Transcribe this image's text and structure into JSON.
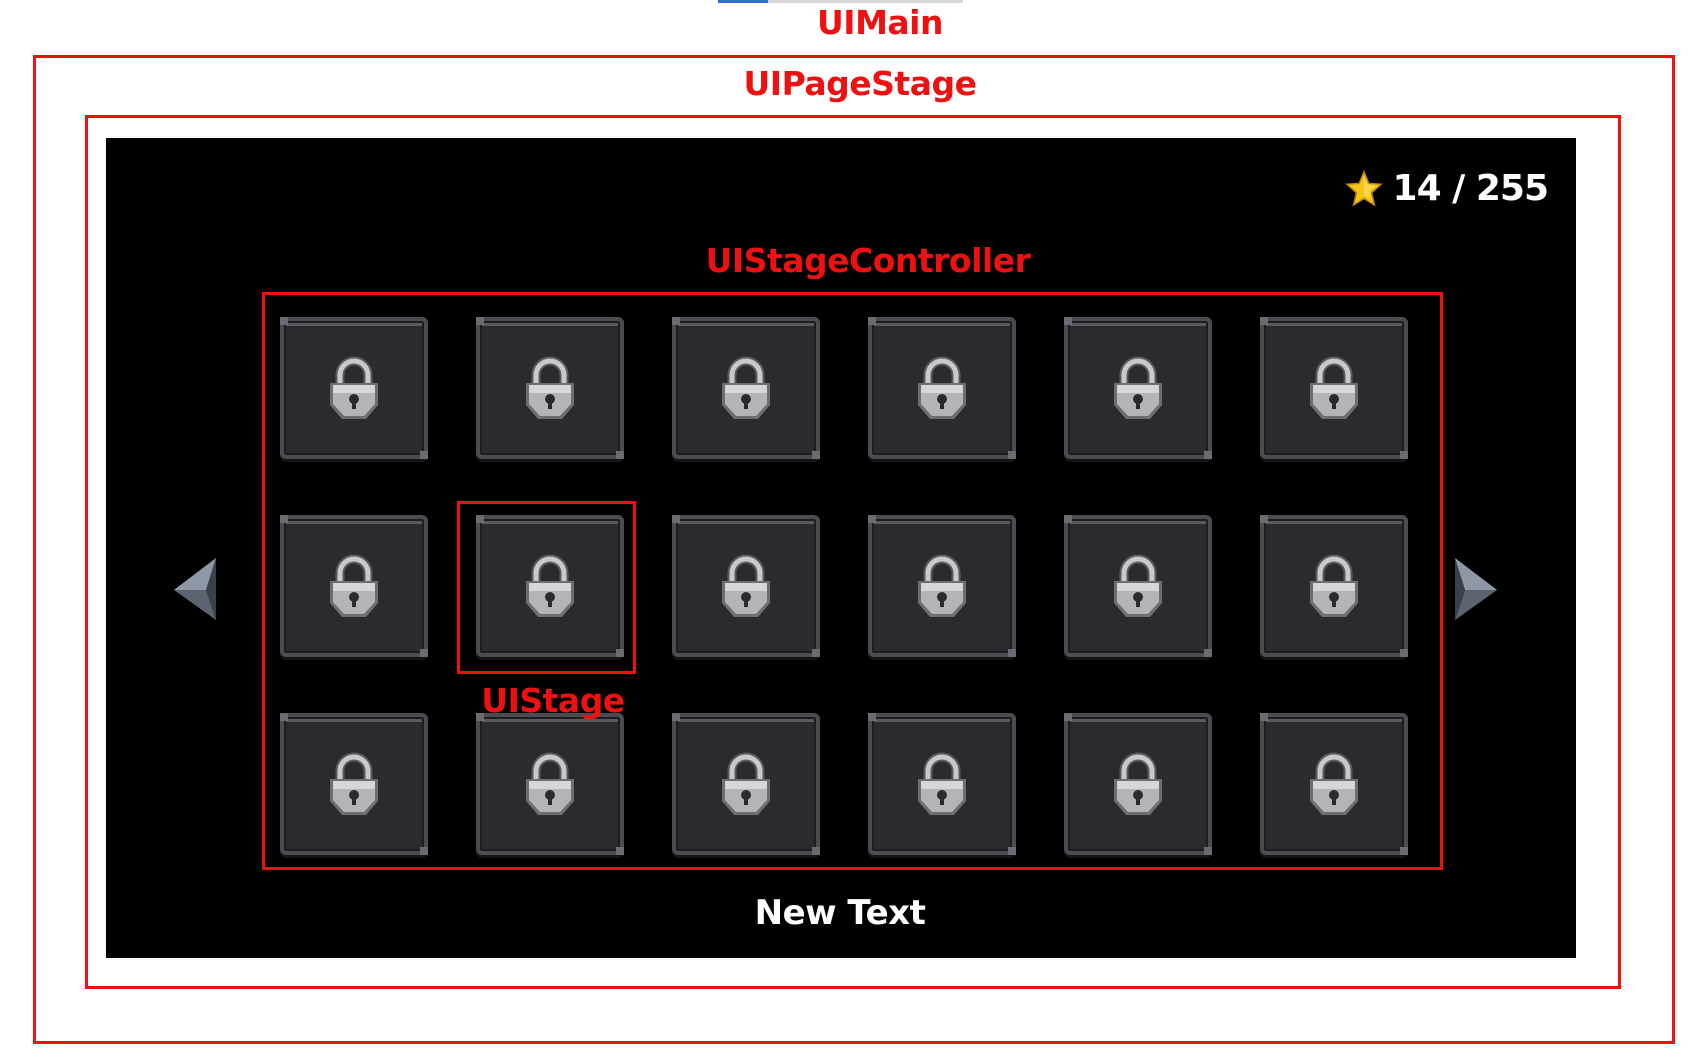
{
  "annotations": {
    "main_label": "UIMain",
    "page_label": "UIPageStage",
    "controller_label": "UIStageController",
    "stage_label": "UIStage"
  },
  "hud": {
    "star_icon": "star-icon",
    "star_count": "14 / 255"
  },
  "stage_grid": {
    "rows": 3,
    "columns": 6,
    "tiles": [
      {
        "state": "locked"
      },
      {
        "state": "locked"
      },
      {
        "state": "locked"
      },
      {
        "state": "locked"
      },
      {
        "state": "locked"
      },
      {
        "state": "locked"
      },
      {
        "state": "locked"
      },
      {
        "state": "locked"
      },
      {
        "state": "locked"
      },
      {
        "state": "locked"
      },
      {
        "state": "locked"
      },
      {
        "state": "locked"
      },
      {
        "state": "locked"
      },
      {
        "state": "locked"
      },
      {
        "state": "locked"
      },
      {
        "state": "locked"
      },
      {
        "state": "locked"
      },
      {
        "state": "locked"
      }
    ],
    "lock_icon": "lock-icon",
    "highlighted_tile": 7
  },
  "navigation": {
    "prev_icon": "arrow-left-icon",
    "next_icon": "arrow-right-icon"
  },
  "footer_text": "New Text",
  "colors": {
    "annotation_red": "#ee1111",
    "screen_bg": "#000000",
    "tile_bg": "#2b2a2f",
    "tile_border": "#4c4b52",
    "star": "#f5c518"
  }
}
